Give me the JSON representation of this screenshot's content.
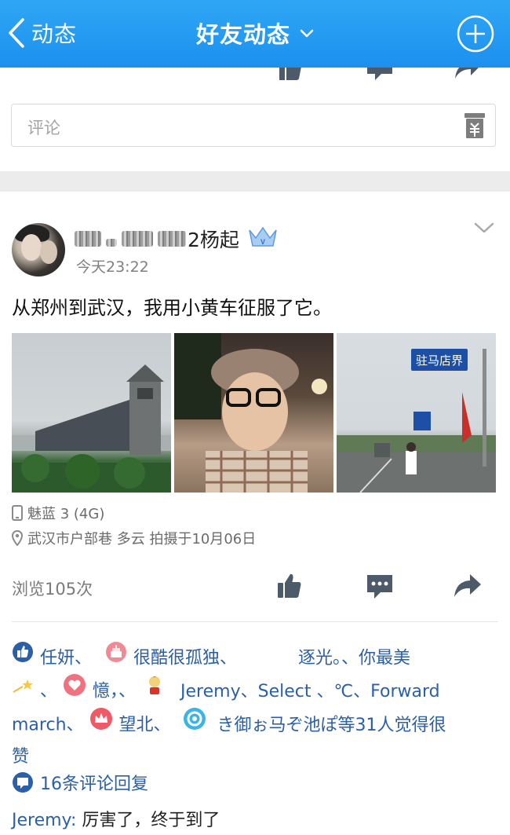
{
  "header": {
    "back_label": "动态",
    "title": "好友动态",
    "accent": "#1c90ee"
  },
  "comment_input": {
    "placeholder": "评论",
    "gift_icon": "gift-box-icon"
  },
  "post": {
    "author_suffix": "2杨起",
    "author_badge": "vip-crown-icon",
    "time": "今天23:22",
    "text": "从郑州到武汉，我用小黄车征服了它。",
    "photos": [
      "bridge-photo",
      "selfie-photo",
      "road-sign-photo"
    ],
    "road_sign_text": "驻马店界",
    "device": "魅蓝 3 (4G)",
    "location": "武汉市户部巷 多云 拍摄于10月06日",
    "views": "浏览105次",
    "actions": [
      "like-icon",
      "comment-icon",
      "share-icon"
    ],
    "likes": {
      "line1": [
        "任妍、",
        "很酷很孤独、",
        "逐光。、你最美"
      ],
      "line2": [
        "、",
        "憶，、",
        "Jeremy、Select 、℃、Forward"
      ],
      "line3": [
        "march、",
        "望北、",
        "き御ぉ马ぞ池ぽ等31人觉得很"
      ],
      "line4": "赞"
    },
    "comment_count": "16条评论回复",
    "first_comment": {
      "author": "Jeremy:",
      "text": " 厉害了，终于到了"
    },
    "link_color": "#2b5fa8"
  }
}
